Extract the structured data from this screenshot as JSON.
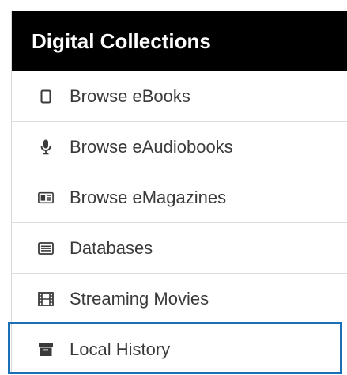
{
  "panel": {
    "title": "Digital Collections",
    "items": [
      {
        "label": "Browse eBooks",
        "icon": "tablet-icon"
      },
      {
        "label": "Browse eAudiobooks",
        "icon": "microphone-icon"
      },
      {
        "label": "Browse eMagazines",
        "icon": "newspaper-icon"
      },
      {
        "label": "Databases",
        "icon": "list-box-icon"
      },
      {
        "label": "Streaming Movies",
        "icon": "film-icon"
      },
      {
        "label": "Local History",
        "icon": "archive-box-icon",
        "selected": true
      }
    ]
  },
  "colors": {
    "header_bg": "#000000",
    "header_text": "#ffffff",
    "item_text": "#3a3a3a",
    "focus_outline": "#1a6fb5"
  }
}
